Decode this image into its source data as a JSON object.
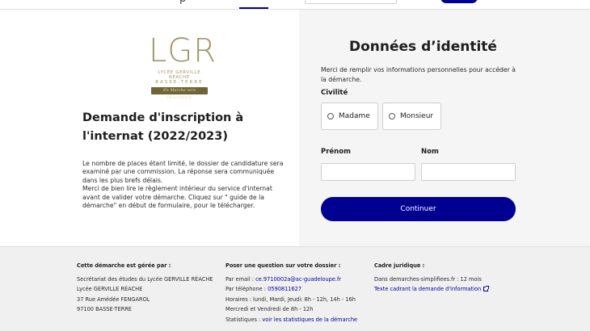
{
  "header": {
    "peek_text": "p"
  },
  "logo": {
    "monogram": "LGR",
    "name_line1": "LYCÉE GERVILLE RÉACHE",
    "name_line2": "BASSE-TERRE",
    "motto": "En Marche vers l'Excellence"
  },
  "demarche": {
    "title": "Demande d'inscription à l'internat (2022/2023)",
    "description": [
      "Le nombre de places étant limité, le dossier de candidature sera examiné par une commission. La réponse sera communiquée dans les plus brefs délais.",
      "Merci de bien lire le règlement intérieur du service d'internat avant de valider votre démarche. Cliquez sur \" guide de la démarche\" en début de formulaire, pour le télécharger."
    ]
  },
  "form": {
    "title": "Données d’identité",
    "intro": "Merci de remplir vos informations personnelles pour accéder à la démarche.",
    "civilite_label": "Civilité",
    "options": [
      "Madame",
      "Monsieur"
    ],
    "prenom_label": "Prénom",
    "prenom_value": "",
    "nom_label": "Nom",
    "nom_value": "",
    "continue_label": "Continuer"
  },
  "footer": {
    "col1": {
      "heading": "Cette démarche est gérée par :",
      "lines": [
        "Secrétariat des études du Lycée GERVILLE RÉACHE",
        "Lycée GERVILLE RÉACHE",
        "37 Rue Amédée FENGAROL",
        "97100 BASSE-TERRE"
      ]
    },
    "col2": {
      "heading": "Poser une question sur votre dossier :",
      "email_label": "Par email : ",
      "email": "ce.9710002a@ac-guadeloupe.fr",
      "phone_label": "Par téléphone : ",
      "phone": "0590811627",
      "hours1": "Horaires : lundi, Mardi, Jeudi: 8h - 12h, 14h - 16h",
      "hours2": "Mercredi et Vendredi de 8h - 12h",
      "stats_label": "Statistiques : ",
      "stats_link": "voir les statistiques de la démarche"
    },
    "col3": {
      "heading": "Cadre juridique :",
      "line1": "Dans demarches-simplifiees.fr : 12 mois",
      "link_prefix": "Texte cadrant ",
      "link_text": "la demande d'information"
    }
  },
  "colors": {
    "primary": "#000091",
    "logo_gold": "#a4946a",
    "panel_grey": "#f5f5f5",
    "footer_grey": "#f0f0f0"
  }
}
